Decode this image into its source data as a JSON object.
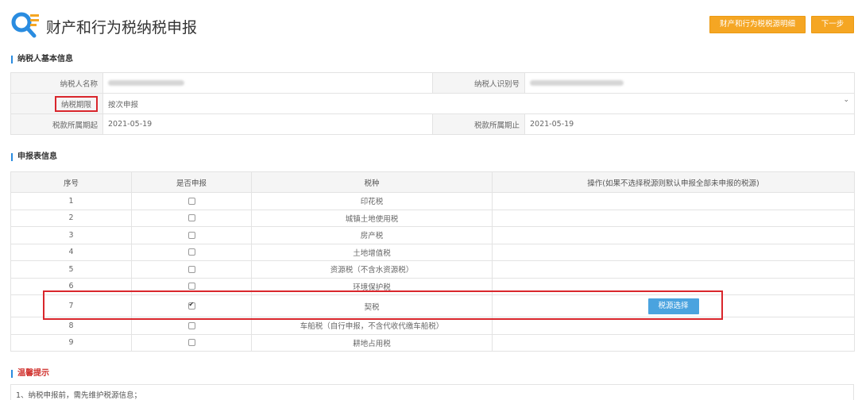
{
  "header": {
    "title": "财产和行为税纳税申报",
    "source_button": "财产和行为税税源明细",
    "next_button": "下一步"
  },
  "basic_info": {
    "section_title": "纳税人基本信息",
    "taxpayer_name_label": "纳税人名称",
    "taxpayer_id_label": "纳税人识别号",
    "period_label": "纳税期限",
    "period_value": "按次申报",
    "start_label": "税款所属期起",
    "start_value": "2021-05-19",
    "end_label": "税款所属期止",
    "end_value": "2021-05-19"
  },
  "declaration": {
    "section_title": "申报表信息",
    "columns": [
      "序号",
      "是否申报",
      "税种",
      "操作(如果不选择税源则默认申报全部未申报的税源)"
    ],
    "rows": [
      {
        "no": "1",
        "tax": "印花税",
        "checked": false
      },
      {
        "no": "2",
        "tax": "城镇土地使用税",
        "checked": false
      },
      {
        "no": "3",
        "tax": "房产税",
        "checked": false
      },
      {
        "no": "4",
        "tax": "土地增值税",
        "checked": false
      },
      {
        "no": "5",
        "tax": "资源税（不含水资源税）",
        "checked": false
      },
      {
        "no": "6",
        "tax": "环境保护税",
        "checked": false
      },
      {
        "no": "7",
        "tax": "契税",
        "checked": true,
        "action": "税源选择"
      },
      {
        "no": "8",
        "tax": "车船税（自行申报，不含代收代缴车船税）",
        "checked": false
      },
      {
        "no": "9",
        "tax": "耕地占用税",
        "checked": false
      }
    ]
  },
  "tips": {
    "section_title": "温馨提示",
    "line1": "1、纳税申报前，需先维护税源信息；"
  },
  "colors": {
    "accent_orange": "#f5a623",
    "button_blue": "#4aa3df",
    "highlight_red": "#d9262c",
    "section_bar_blue": "#2a8ce0"
  }
}
